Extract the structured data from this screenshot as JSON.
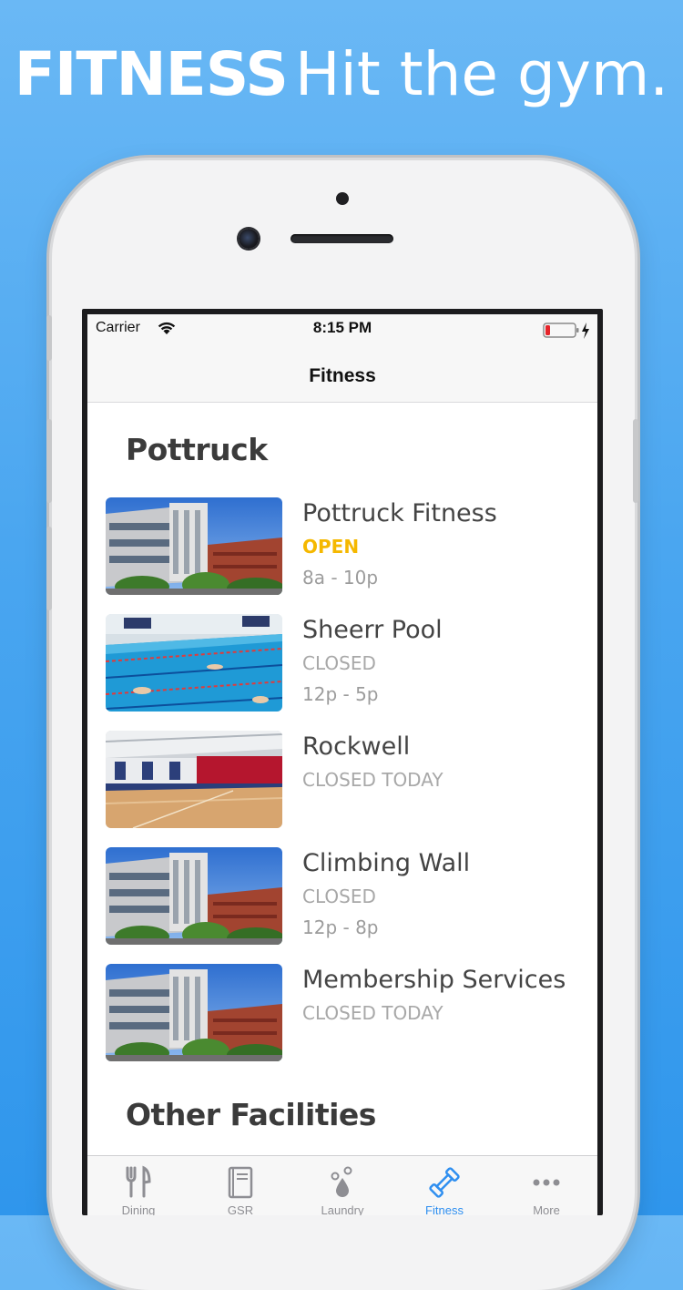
{
  "headline": {
    "strong": "FITNESS",
    "light": "Hit the gym."
  },
  "status_bar": {
    "carrier": "Carrier",
    "time": "8:15 PM"
  },
  "nav": {
    "title": "Fitness"
  },
  "sections": [
    {
      "title": "Pottruck",
      "items": [
        {
          "name": "Pottruck Fitness",
          "status": "OPEN",
          "status_color": "#f5b800",
          "hours": "8a - 10p",
          "image": "building-photo"
        },
        {
          "name": "Sheerr Pool",
          "status": "CLOSED",
          "status_color": "#a8a8a8",
          "hours": "12p - 5p",
          "image": "pool-photo"
        },
        {
          "name": "Rockwell",
          "status": "CLOSED TODAY",
          "status_color": "#a8a8a8",
          "hours": "",
          "image": "gym-court-photo"
        },
        {
          "name": "Climbing Wall",
          "status": "CLOSED",
          "status_color": "#a8a8a8",
          "hours": "12p - 8p",
          "image": "building-photo"
        },
        {
          "name": "Membership Services",
          "status": "CLOSED TODAY",
          "status_color": "#a8a8a8",
          "hours": "",
          "image": "building-photo"
        }
      ]
    },
    {
      "title": "Other Facilities",
      "items": []
    }
  ],
  "tabs": [
    {
      "label": "Dining",
      "icon": "fork-knife-icon",
      "active": false
    },
    {
      "label": "GSR",
      "icon": "book-icon",
      "active": false
    },
    {
      "label": "Laundry",
      "icon": "water-drops-icon",
      "active": false
    },
    {
      "label": "Fitness",
      "icon": "dumbbell-icon",
      "active": true
    },
    {
      "label": "More",
      "icon": "more-dots-icon",
      "active": false
    }
  ],
  "colors": {
    "accent": "#2f8ff0",
    "open": "#f5b800",
    "closed": "#a8a8a8",
    "background": "#4aa6f0"
  }
}
